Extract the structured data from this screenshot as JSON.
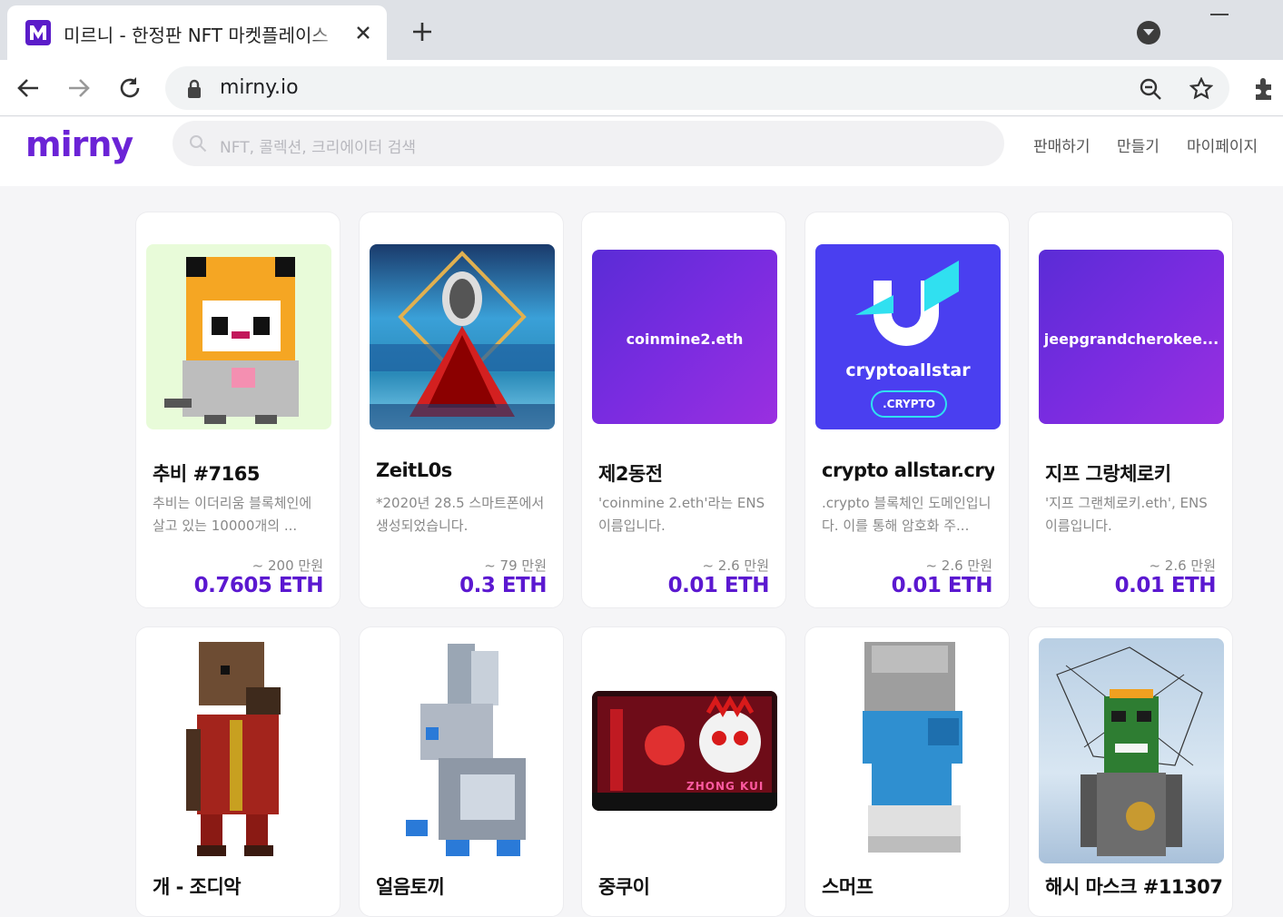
{
  "browser": {
    "tab_title": "미르니 - 한정판 NFT 마켓플레이스",
    "url": "mirny.io"
  },
  "site": {
    "logo": "mirny",
    "search_placeholder": "NFT, 콜렉션, 크리에이터 검색",
    "nav": [
      "판매하기",
      "만들기",
      "마이페이지"
    ]
  },
  "cards_row1": [
    {
      "title": "추비 #7165",
      "desc": "추비는 이더리움 블록체인에 살고 있는 10000개의 ...",
      "krw": "~ 200 만원",
      "eth": "0.7605 ETH"
    },
    {
      "title": "ZeitL0s",
      "desc": "*2020년 28.5 스마트폰에서 생성되었습니다.",
      "krw": "~ 79 만원",
      "eth": "0.3 ETH"
    },
    {
      "title": "제2동전",
      "desc": "'coinmine 2.eth'라는 ENS 이름입니다.",
      "krw": "~ 2.6 만원",
      "eth": "0.01 ETH",
      "art_label": "coinmine2.eth"
    },
    {
      "title": "crypto allstar.crypto",
      "desc": ".crypto 블록체인 도메인입니다. 이를 통해 암호화 주...",
      "krw": "~ 2.6 만원",
      "eth": "0.01 ETH",
      "art_label": "cryptoallstar",
      "art_badge": ".CRYPTO"
    },
    {
      "title": "지프 그랑체로키",
      "desc": "'지프 그랜체로키.eth', ENS 이름입니다.",
      "krw": "~ 2.6 만원",
      "eth": "0.01 ETH",
      "art_label": "jeepgrandcherokee..."
    }
  ],
  "cards_row2": [
    {
      "title": "개 - 조디악"
    },
    {
      "title": "얼음토끼"
    },
    {
      "title": "중쿠이",
      "art_text": "ZHONG KUI"
    },
    {
      "title": "스머프"
    },
    {
      "title": "해시 마스크 #11307"
    }
  ]
}
